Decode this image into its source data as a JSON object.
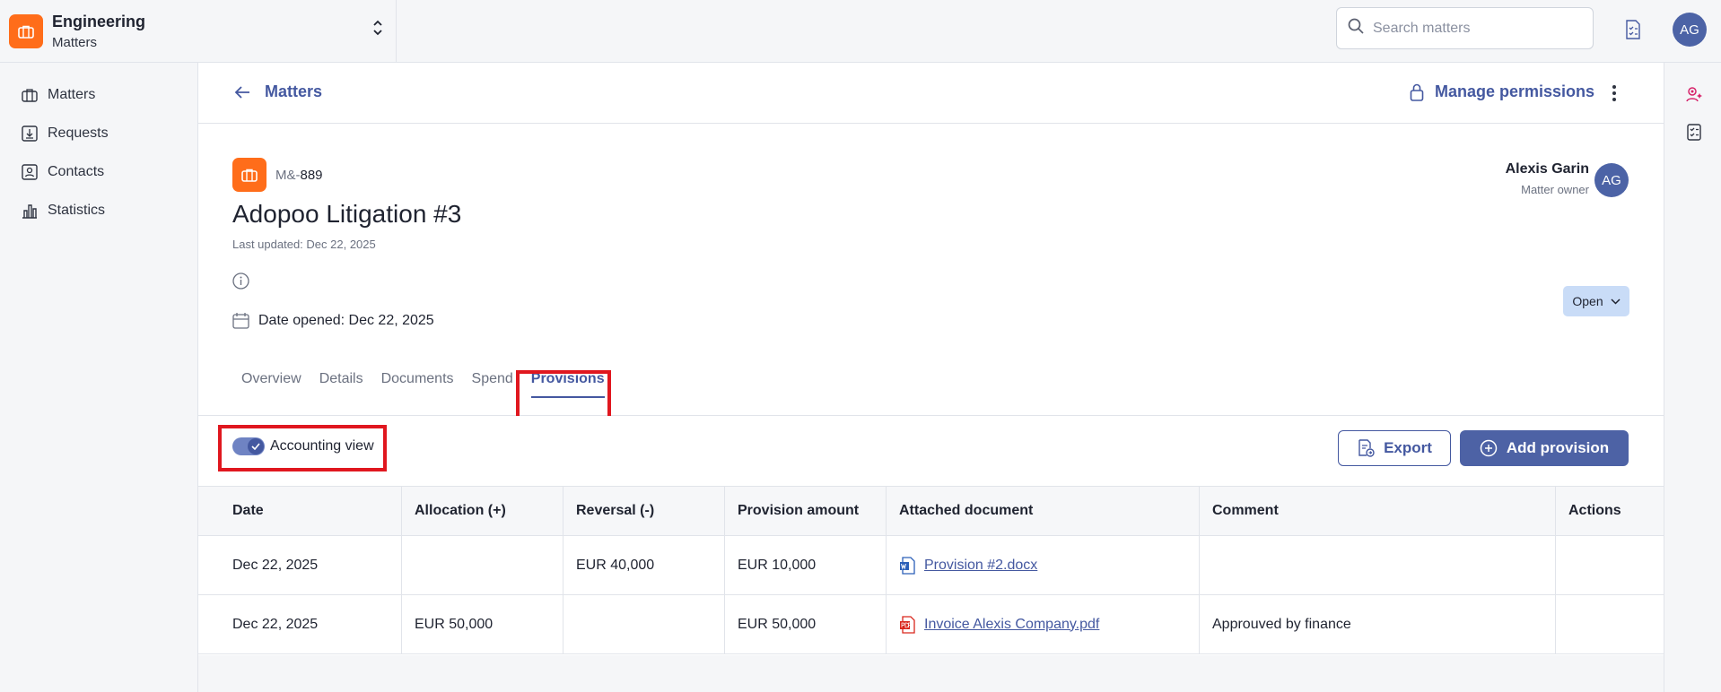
{
  "workspace": {
    "name": "Engineering",
    "subtitle": "Matters"
  },
  "search": {
    "placeholder": "Search matters"
  },
  "user": {
    "initials": "AG"
  },
  "nav": [
    {
      "label": "Matters",
      "icon": "briefcase-icon"
    },
    {
      "label": "Requests",
      "icon": "inbox-download-icon"
    },
    {
      "label": "Contacts",
      "icon": "contact-card-icon"
    },
    {
      "label": "Statistics",
      "icon": "bar-chart-icon"
    }
  ],
  "header": {
    "back_label": "Matters",
    "manage_label": "Manage permissions"
  },
  "matter": {
    "code_prefix": "M&-",
    "code_number": "889",
    "title": "Adopoo Litigation #3",
    "last_updated": "Last updated: Dec 22, 2025",
    "date_opened": "Date opened: Dec 22, 2025",
    "status": "Open",
    "owner_name": "Alexis Garin",
    "owner_role": "Matter owner",
    "owner_initials": "AG"
  },
  "tabs": [
    "Overview",
    "Details",
    "Documents",
    "Spend",
    "Provisions"
  ],
  "active_tab": "Provisions",
  "toolbar": {
    "toggle_label": "Accounting view",
    "toggle_on": true,
    "export_label": "Export",
    "add_label": "Add provision"
  },
  "table": {
    "columns": [
      "Date",
      "Allocation (+)",
      "Reversal (-)",
      "Provision amount",
      "Attached document",
      "Comment",
      "Actions"
    ],
    "rows": [
      {
        "date": "Dec 22, 2025",
        "allocation": "",
        "reversal": "EUR 40,000",
        "amount": "EUR 10,000",
        "document": "Provision #2.docx",
        "doc_type": "word-doc-icon",
        "comment": ""
      },
      {
        "date": "Dec 22, 2025",
        "allocation": "EUR 50,000",
        "reversal": "",
        "amount": "EUR 50,000",
        "document": "Invoice Alexis Company.pdf",
        "doc_type": "pdf-doc-icon",
        "comment": "Approuved by finance"
      }
    ]
  },
  "colors": {
    "accent": "#4458a0",
    "brand_orange": "#ff6d1a",
    "highlight_red": "#e0171f",
    "status_bg": "#c9dcf7"
  }
}
